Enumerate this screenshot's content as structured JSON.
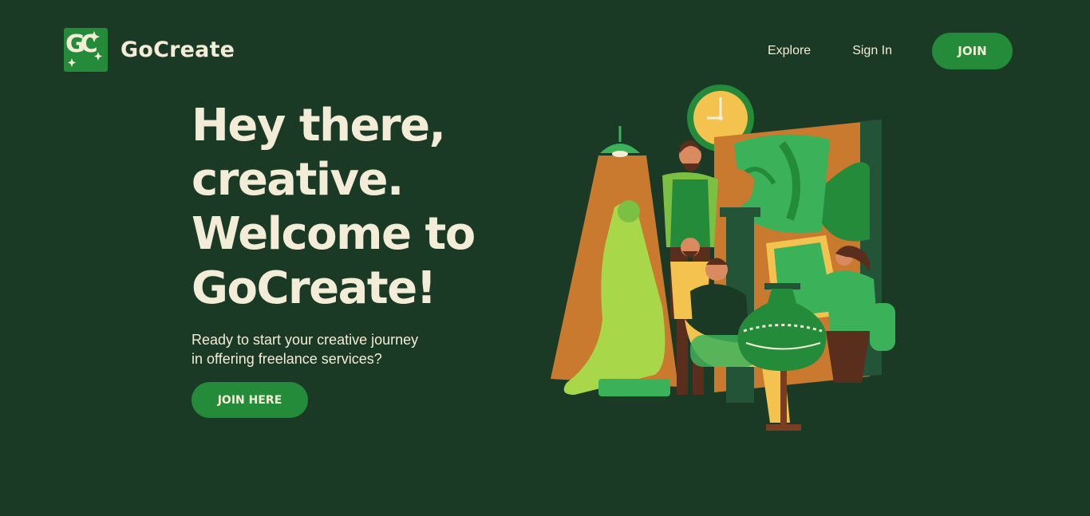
{
  "brand": {
    "name": "GoCreate",
    "logo_letters": "GC"
  },
  "nav": {
    "explore": "Explore",
    "sign_in": "Sign In",
    "join": "JOIN"
  },
  "hero": {
    "title_line1": "Hey there,",
    "title_line2": "creative.",
    "title_line3": "Welcome to",
    "title_line4": "GoCreate!",
    "subtitle_line1": "Ready to start your creative journey",
    "subtitle_line2": "in offering freelance services?",
    "cta": "JOIN HERE"
  },
  "colors": {
    "background": "#1a3a26",
    "accent": "#238b3a",
    "text": "#f3ecd6"
  },
  "icons": {
    "logo": "gocreate-logo-icon",
    "illustration": "artists-studio-illustration"
  }
}
